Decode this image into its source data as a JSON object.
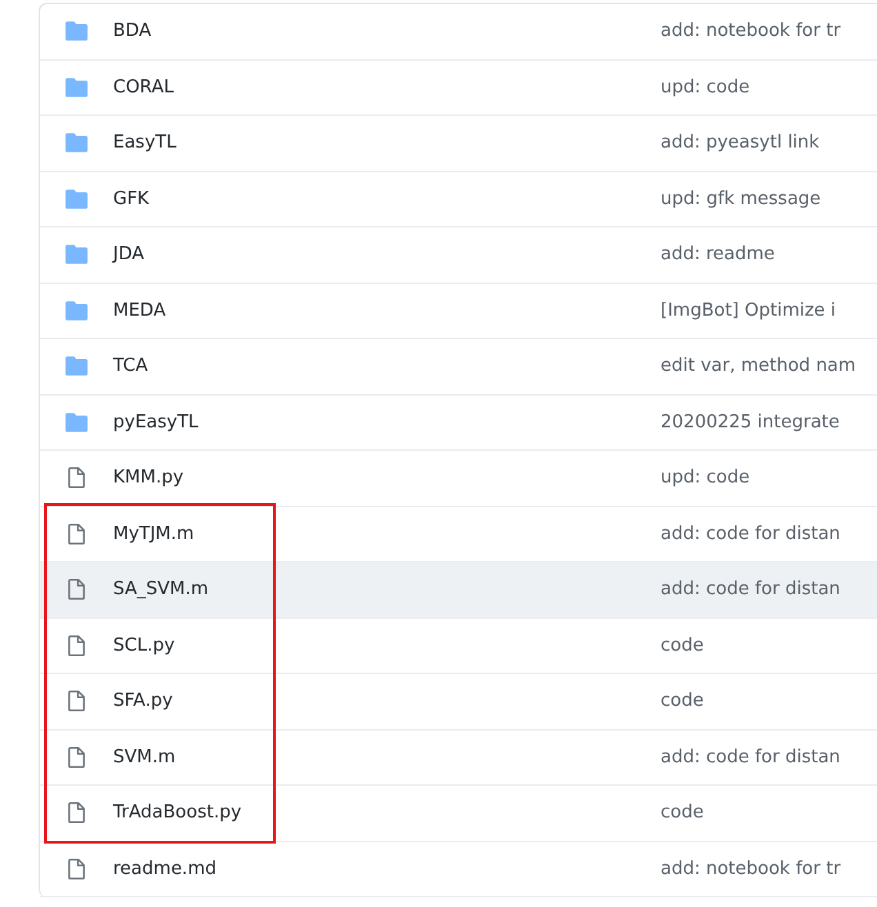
{
  "files": [
    {
      "kind": "folder",
      "name": "BDA",
      "message": "add: notebook for tr",
      "hovered": false
    },
    {
      "kind": "folder",
      "name": "CORAL",
      "message": "upd: code",
      "hovered": false
    },
    {
      "kind": "folder",
      "name": "EasyTL",
      "message": "add: pyeasytl link",
      "hovered": false
    },
    {
      "kind": "folder",
      "name": "GFK",
      "message": "upd: gfk message",
      "hovered": false
    },
    {
      "kind": "folder",
      "name": "JDA",
      "message": "add: readme",
      "hovered": false
    },
    {
      "kind": "folder",
      "name": "MEDA",
      "message": "[ImgBot] Optimize i",
      "hovered": false
    },
    {
      "kind": "folder",
      "name": "TCA",
      "message": "edit var, method nam",
      "hovered": false
    },
    {
      "kind": "folder",
      "name": "pyEasyTL",
      "message": "20200225 integrate",
      "hovered": false
    },
    {
      "kind": "file",
      "name": "KMM.py",
      "message": "upd: code",
      "hovered": false
    },
    {
      "kind": "highlight",
      "children": [
        {
          "kind": "file",
          "name": "MyTJM.m",
          "message": "add: code for distan",
          "hovered": false
        },
        {
          "kind": "file",
          "name": "SA_SVM.m",
          "message": "add: code for distan",
          "hovered": true
        },
        {
          "kind": "file",
          "name": "SCL.py",
          "message": "code",
          "hovered": false
        },
        {
          "kind": "file",
          "name": "SFA.py",
          "message": "code",
          "hovered": false
        },
        {
          "kind": "file",
          "name": "SVM.m",
          "message": "add: code for distan",
          "hovered": false
        },
        {
          "kind": "file",
          "name": "TrAdaBoost.py",
          "message": "code",
          "hovered": false
        }
      ]
    },
    {
      "kind": "file",
      "name": "readme.md",
      "message": "add: notebook for tr",
      "hovered": false
    }
  ]
}
